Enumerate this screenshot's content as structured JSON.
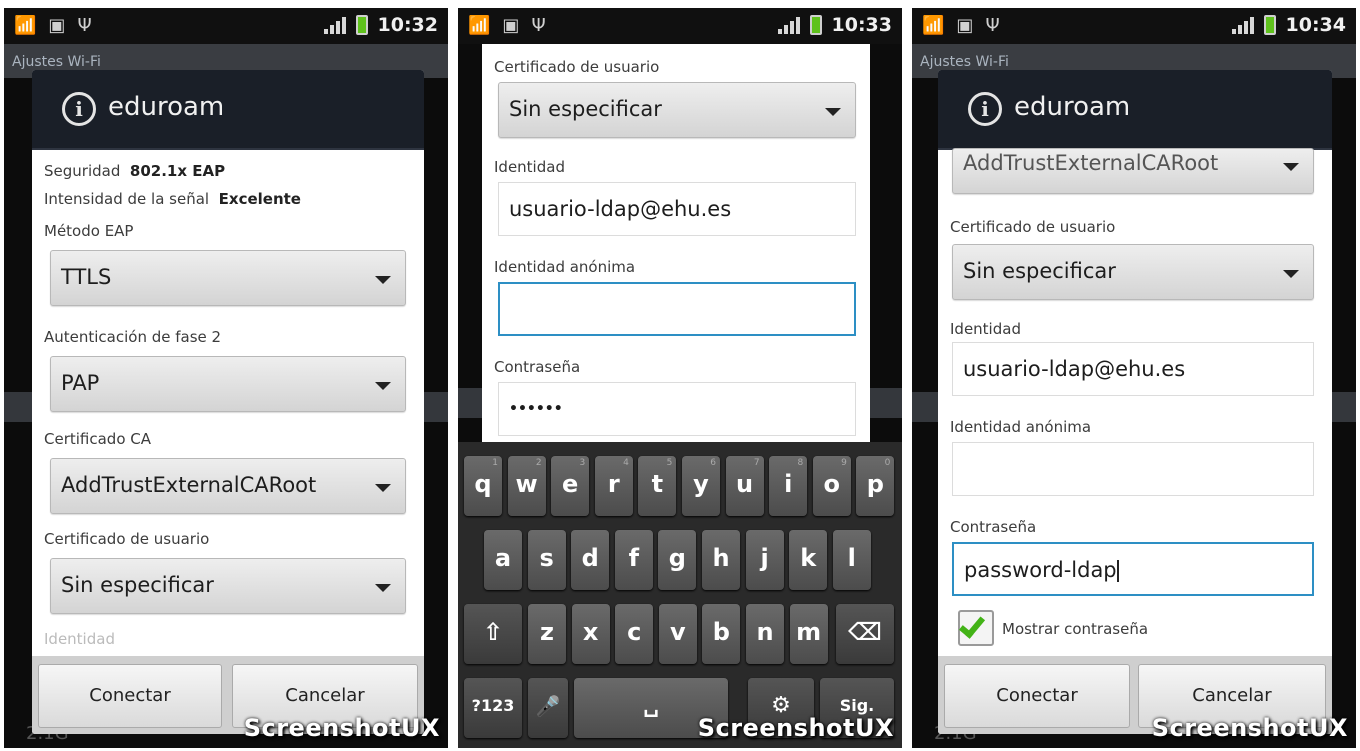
{
  "status_bar": {
    "s1_time": "10:32",
    "s2_time": "10:33",
    "s3_time": "10:34"
  },
  "background": {
    "title": "Ajustes Wi-Fi",
    "footer": "2.1G"
  },
  "watermark": "ScreenshotUX",
  "dialog": {
    "title": "eduroam",
    "security_label": "Seguridad",
    "security_value": "802.1x EAP",
    "signal_label": "Intensidad de la señal",
    "signal_value": "Excelente",
    "eap_label": "Método EAP",
    "eap_value": "TTLS",
    "phase2_label": "Autenticación de fase 2",
    "phase2_value": "PAP",
    "ca_label": "Certificado CA",
    "ca_value": "AddTrustExternalCARoot",
    "user_cert_label": "Certificado de usuario",
    "user_cert_value": "Sin especificar",
    "identity_label": "Identidad",
    "identity_value": "usuario-ldap@ehu.es",
    "anon_label": "Identidad anónima",
    "anon_value": "",
    "password_label": "Contraseña",
    "password_masked": "••••••",
    "password_value": "password-ldap",
    "show_password_label": "Mostrar contraseña",
    "show_password_checked": true,
    "connect_label": "Conectar",
    "cancel_label": "Cancelar"
  },
  "keyboard": {
    "row1": [
      "q",
      "w",
      "e",
      "r",
      "t",
      "y",
      "u",
      "i",
      "o",
      "p"
    ],
    "row1_sup": [
      "1",
      "2",
      "3",
      "4",
      "5",
      "6",
      "7",
      "8",
      "9",
      "0"
    ],
    "row2": [
      "a",
      "s",
      "d",
      "f",
      "g",
      "h",
      "j",
      "k",
      "l"
    ],
    "row3": [
      "z",
      "x",
      "c",
      "v",
      "b",
      "n",
      "m"
    ],
    "shift": "⇧",
    "backspace": "⌫",
    "symbols": "?123",
    "mic": "🎤",
    "space": "␣",
    "settings": "⚙",
    "next": "Sig."
  }
}
